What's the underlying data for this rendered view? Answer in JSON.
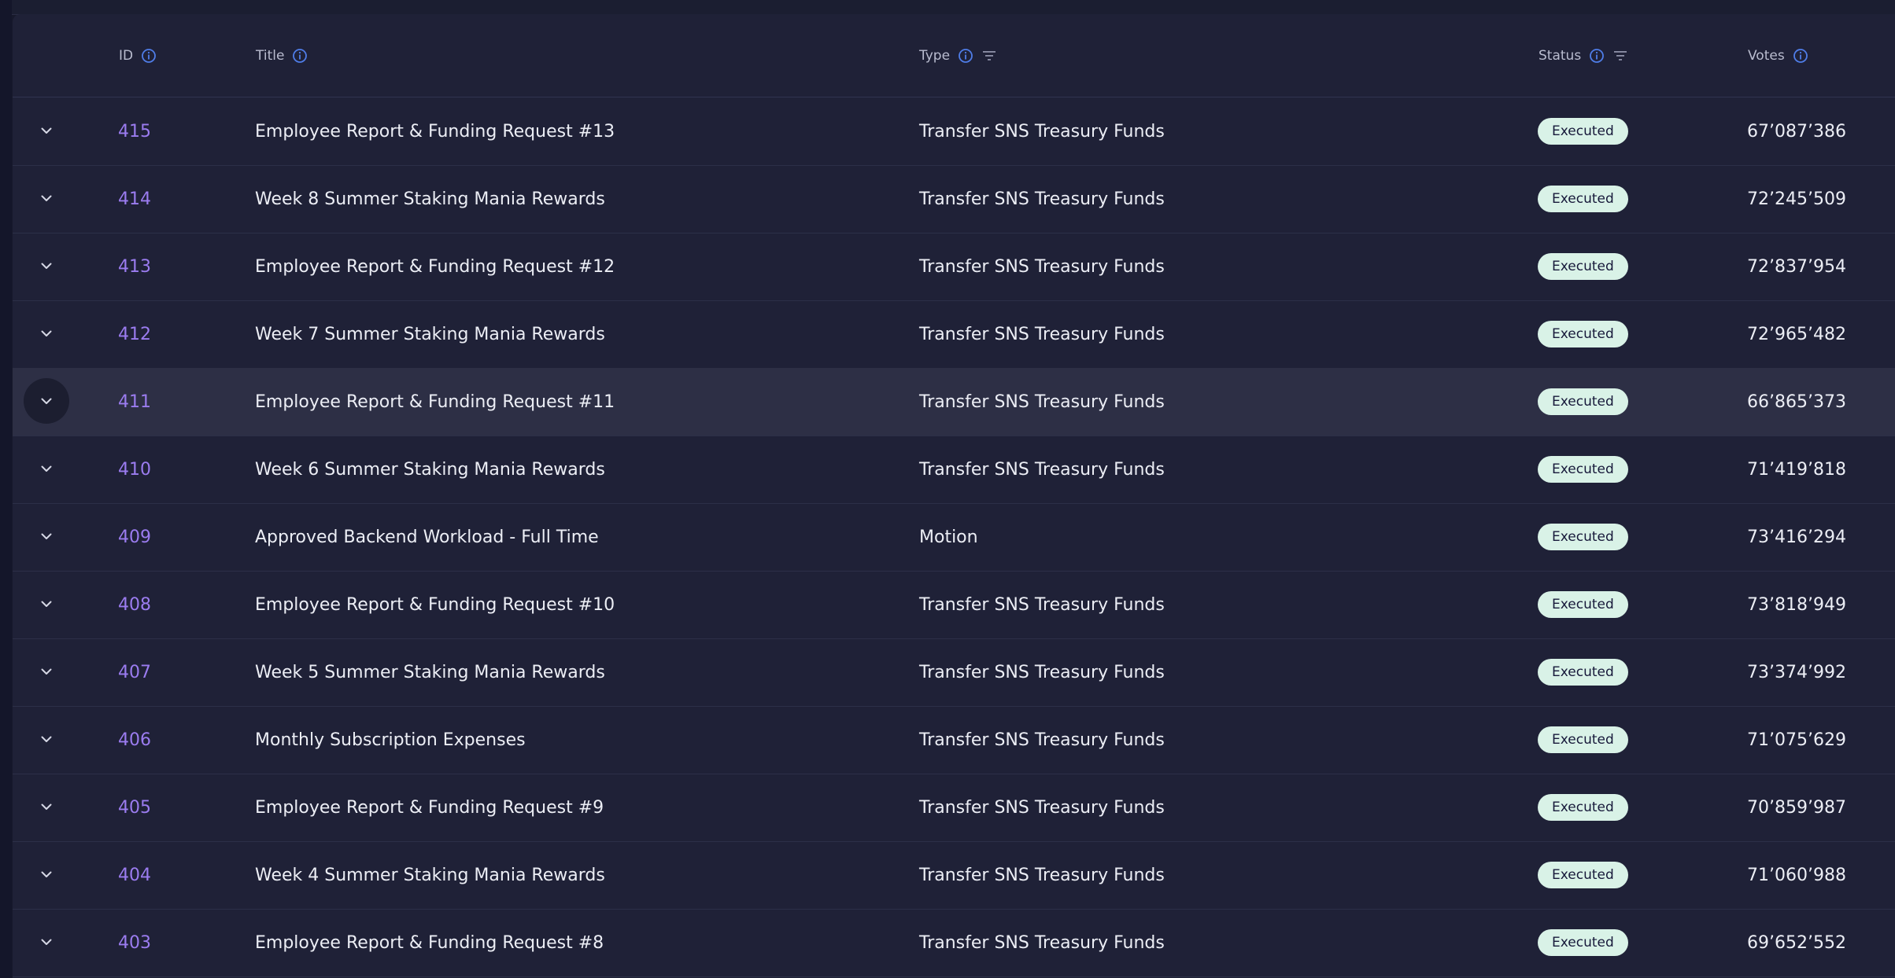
{
  "table": {
    "headers": {
      "id": "ID",
      "title": "Title",
      "type": "Type",
      "status": "Status",
      "votes": "Votes"
    },
    "rows": [
      {
        "id": "415",
        "title": "Employee Report & Funding Request #13",
        "type": "Transfer SNS Treasury Funds",
        "status": "Executed",
        "votes": "67’087’386"
      },
      {
        "id": "414",
        "title": "Week 8 Summer Staking Mania Rewards",
        "type": "Transfer SNS Treasury Funds",
        "status": "Executed",
        "votes": "72’245’509"
      },
      {
        "id": "413",
        "title": "Employee Report & Funding Request #12",
        "type": "Transfer SNS Treasury Funds",
        "status": "Executed",
        "votes": "72’837’954"
      },
      {
        "id": "412",
        "title": "Week 7 Summer Staking Mania Rewards",
        "type": "Transfer SNS Treasury Funds",
        "status": "Executed",
        "votes": "72’965’482"
      },
      {
        "id": "411",
        "title": "Employee Report & Funding Request #11",
        "type": "Transfer SNS Treasury Funds",
        "status": "Executed",
        "votes": "66’865’373"
      },
      {
        "id": "410",
        "title": "Week 6 Summer Staking Mania Rewards",
        "type": "Transfer SNS Treasury Funds",
        "status": "Executed",
        "votes": "71’419’818"
      },
      {
        "id": "409",
        "title": "Approved Backend Workload - Full Time",
        "type": "Motion",
        "status": "Executed",
        "votes": "73’416’294"
      },
      {
        "id": "408",
        "title": "Employee Report & Funding Request #10",
        "type": "Transfer SNS Treasury Funds",
        "status": "Executed",
        "votes": "73’818’949"
      },
      {
        "id": "407",
        "title": "Week 5 Summer Staking Mania Rewards",
        "type": "Transfer SNS Treasury Funds",
        "status": "Executed",
        "votes": "73’374’992"
      },
      {
        "id": "406",
        "title": "Monthly Subscription Expenses",
        "type": "Transfer SNS Treasury Funds",
        "status": "Executed",
        "votes": "71’075’629"
      },
      {
        "id": "405",
        "title": "Employee Report & Funding Request #9",
        "type": "Transfer SNS Treasury Funds",
        "status": "Executed",
        "votes": "70’859’987"
      },
      {
        "id": "404",
        "title": "Week 4 Summer Staking Mania Rewards",
        "type": "Transfer SNS Treasury Funds",
        "status": "Executed",
        "votes": "71’060’988"
      },
      {
        "id": "403",
        "title": "Employee Report & Funding Request #8",
        "type": "Transfer SNS Treasury Funds",
        "status": "Executed",
        "votes": "69’652’552"
      }
    ]
  },
  "icons": {
    "info": "info-icon",
    "filter": "filter-icon",
    "expand": "chevron-down-icon"
  },
  "colors": {
    "background": "#1f2137",
    "id_link": "#9b7cf0",
    "status_badge": "#d9f2e7",
    "info_icon": "#4f7de8",
    "hover_row": "#2d2f45"
  }
}
